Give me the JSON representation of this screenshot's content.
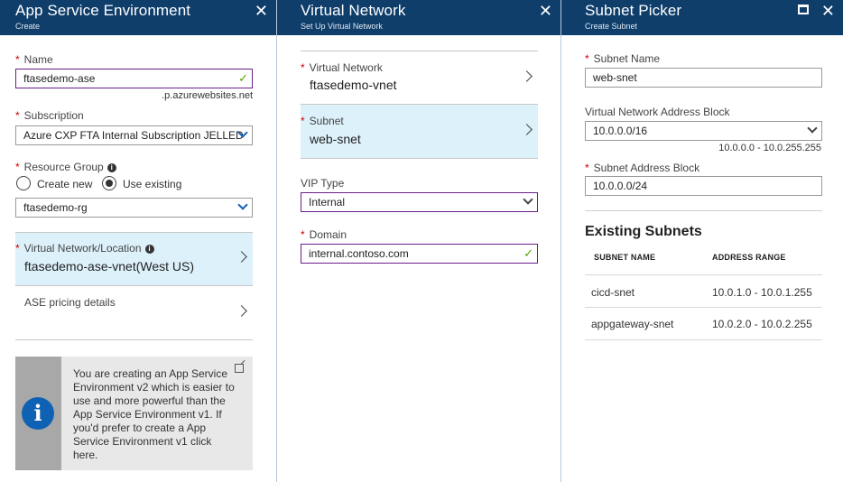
{
  "ase": {
    "title": "App Service Environment",
    "subtitle": "Create",
    "name_label": "Name",
    "name_value": "ftasedemo-ase",
    "name_suffix": ".p.azurewebsites.net",
    "subscription_label": "Subscription",
    "subscription_value": "Azure CXP FTA Internal Subscription JELLED",
    "rg_label": "Resource Group",
    "create_new_label": "Create new",
    "use_existing_label": "Use existing",
    "selected_rg_option": "Use existing",
    "rg_value": "ftasedemo-rg",
    "vnet_location_label": "Virtual Network/Location",
    "vnet_location_value": "ftasedemo-ase-vnet(West US)",
    "pricing_label": "ASE pricing details",
    "info_text": "You are creating an App Service Environment v2 which is easier to use and more powerful than the App Service Environment v1. If you'd prefer to create a App Service Environment v1 click here."
  },
  "vnet": {
    "title": "Virtual Network",
    "subtitle": "Set Up Virtual Network",
    "vnet_label": "Virtual Network",
    "vnet_value": "ftasedemo-vnet",
    "subnet_label": "Subnet",
    "subnet_value": "web-snet",
    "vip_label": "VIP Type",
    "vip_value": "Internal",
    "domain_label": "Domain",
    "domain_value": "internal.contoso.com"
  },
  "subnet": {
    "title": "Subnet Picker",
    "subtitle": "Create Subnet",
    "name_label": "Subnet Name",
    "name_value": "web-snet",
    "vnet_block_label": "Virtual Network Address Block",
    "vnet_block_value": "10.0.0.0/16",
    "vnet_block_range": "10.0.0.0 - 10.0.255.255",
    "address_block_label": "Subnet Address Block",
    "address_block_value": "10.0.0.0/24",
    "existing_title": "Existing Subnets",
    "columns": [
      "SUBNET NAME",
      "ADDRESS RANGE"
    ],
    "rows": [
      {
        "name": "cicd-snet",
        "range": "10.0.1.0 - 10.0.1.255"
      },
      {
        "name": "appgateway-snet",
        "range": "10.0.2.0 - 10.0.2.255"
      }
    ]
  },
  "colors": {
    "header": "#0f3e6b",
    "selected_row": "#ddf1fb",
    "valid_border": "#6b1f8a",
    "check": "#57a300",
    "info_blue": "#0f62b3"
  }
}
